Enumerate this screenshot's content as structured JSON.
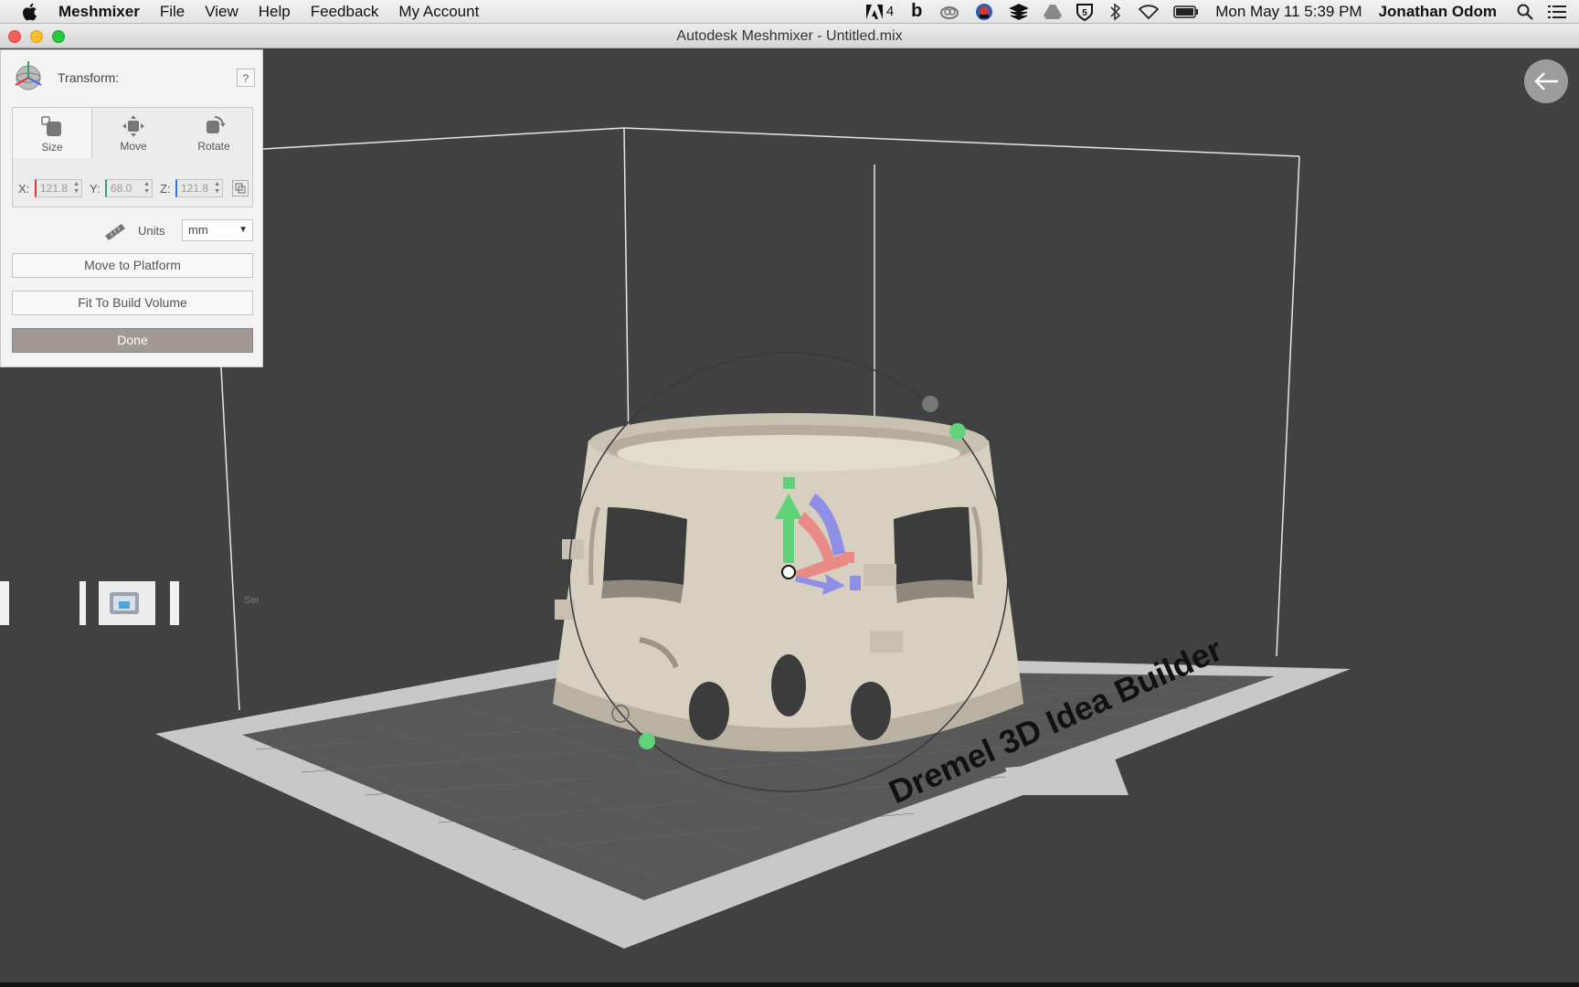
{
  "menubar": {
    "app_name": "Meshmixer",
    "items": [
      "File",
      "View",
      "Help",
      "Feedback",
      "My Account"
    ],
    "status_icons": [
      "adobe-icon",
      "b-icon",
      "creative-cloud-icon",
      "app-badge-icon",
      "layers-icon",
      "drive-icon",
      "shield-5-icon",
      "bluetooth-icon",
      "wifi-icon",
      "battery-icon"
    ],
    "adobe_count": "4",
    "datetime": "Mon May 11  5:39 PM",
    "username": "Jonathan Odom",
    "spotlight_icon": "search-icon",
    "notification_icon": "list-icon"
  },
  "window": {
    "title": "Autodesk Meshmixer - Untitled.mix"
  },
  "transform_panel": {
    "title": "Transform:",
    "help_label": "?",
    "tabs": [
      {
        "label": "Size",
        "active": true
      },
      {
        "label": "Move",
        "active": false
      },
      {
        "label": "Rotate",
        "active": false
      }
    ],
    "x_label": "X:",
    "y_label": "Y:",
    "z_label": "Z:",
    "x_value": "121.8",
    "y_value": "68.0",
    "z_value": "121.8",
    "units_label": "Units",
    "units_value": "mm",
    "move_to_platform": "Move to Platform",
    "fit_to_build_volume": "Fit To Build Volume",
    "done": "Done"
  },
  "viewport": {
    "printer_bed_label": "Dremel 3D Idea Builder",
    "tool_tile_label": "Send To"
  },
  "colors": {
    "viewport_bg": "#414141",
    "model_color": "#d9d2c3",
    "gizmo_green": "#5fd27a",
    "gizmo_red": "#e88b86",
    "gizmo_blue": "#8f8fe8"
  }
}
